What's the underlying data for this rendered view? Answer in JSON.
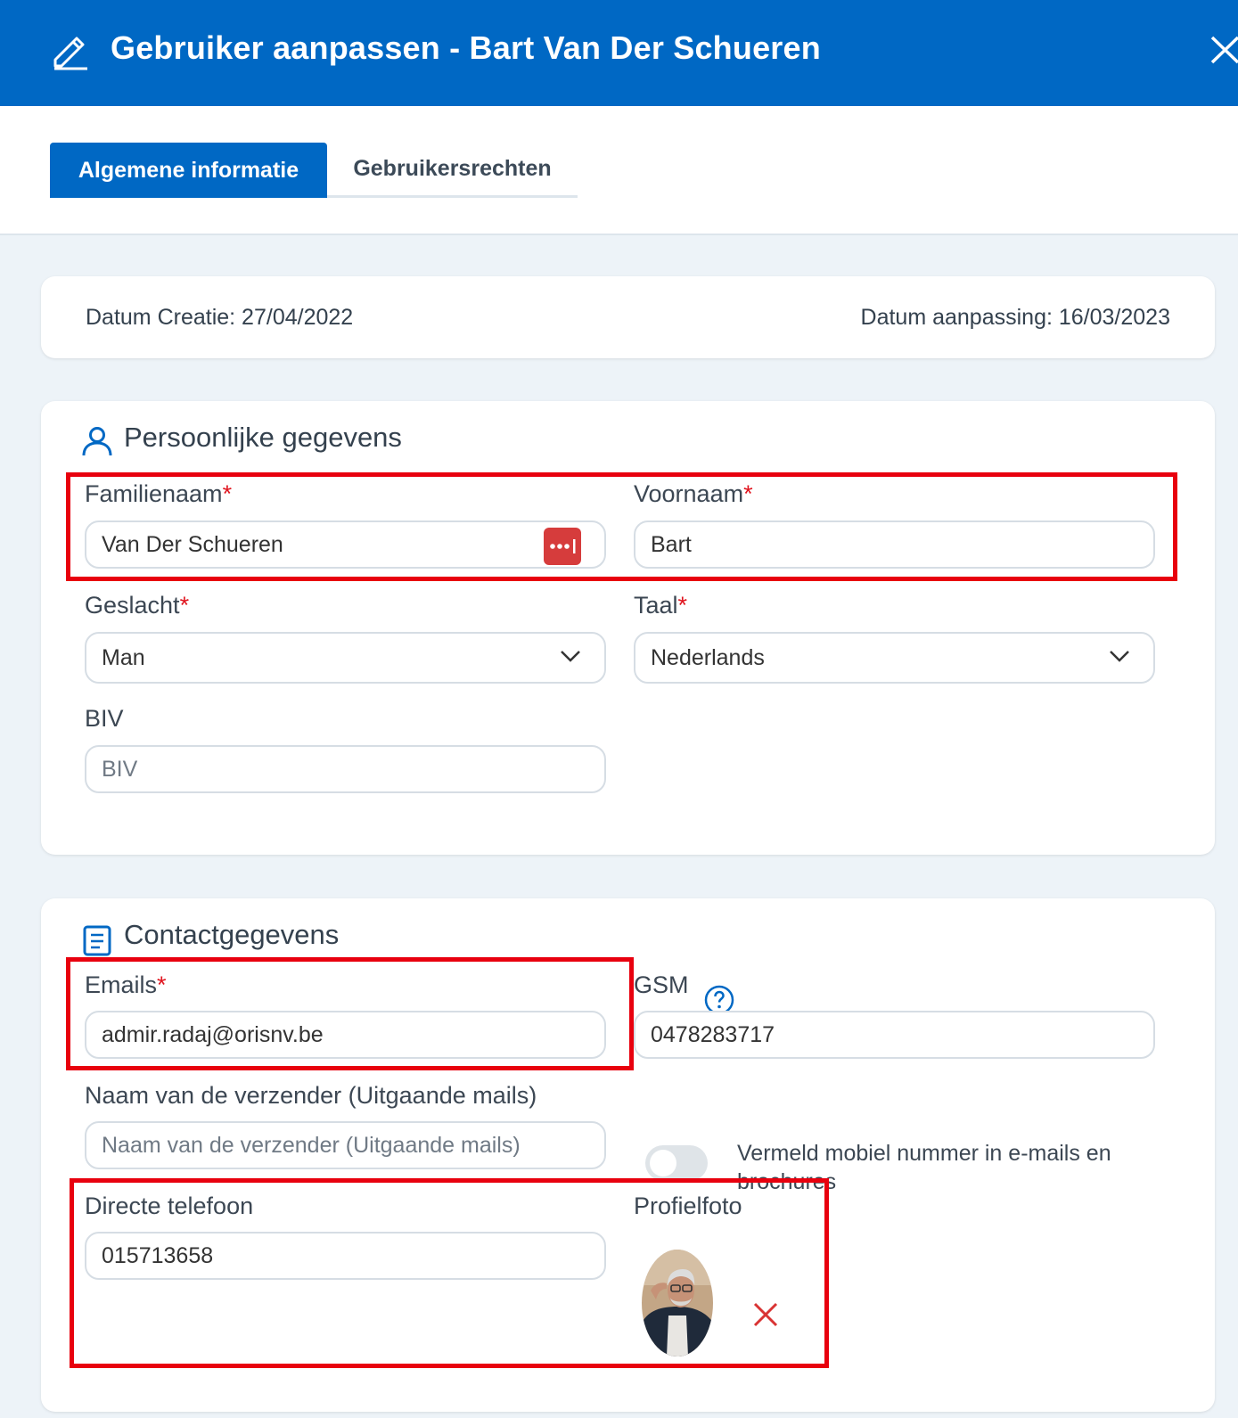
{
  "header": {
    "title": "Gebruiker aanpassen - Bart Van Der Schueren",
    "edit_icon": "pencil-icon",
    "close_icon": "close-icon"
  },
  "tabs": [
    {
      "label": "Algemene informatie",
      "active": true
    },
    {
      "label": "Gebruikersrechten",
      "active": false
    }
  ],
  "dates": {
    "created": "Datum Creatie: 27/04/2022",
    "modified": "Datum aanpassing: 16/03/2023"
  },
  "personal": {
    "title": "Persoonlijke gegevens",
    "icon": "user-icon",
    "familienaam": {
      "label": "Familienaam",
      "value": "Van Der Schueren"
    },
    "voornaam": {
      "label": "Voornaam",
      "value": "Bart"
    },
    "geslacht": {
      "label": "Geslacht",
      "value": "Man"
    },
    "taal": {
      "label": "Taal",
      "value": "Nederlands"
    },
    "biv": {
      "label": "BIV",
      "placeholder": "BIV"
    },
    "required_mark": "*"
  },
  "contact": {
    "title": "Contactgegevens",
    "icon": "document-icon",
    "emails": {
      "label": "Emails",
      "value": "admir.radaj@orisnv.be"
    },
    "gsm": {
      "label": "GSM",
      "value": "0478283717"
    },
    "sender": {
      "label": "Naam van de verzender (Uitgaande mails)",
      "placeholder": "Naam van de verzender (Uitgaande mails)"
    },
    "toggle": {
      "label": "Vermeld mobiel nummer in e-mails en brochures",
      "checked": false
    },
    "direct_phone": {
      "label": "Directe telefoon",
      "value": "015713658"
    },
    "photo": {
      "label": "Profielfoto"
    }
  },
  "colors": {
    "primary": "#0068c4",
    "required": "#e0141e",
    "highlight": "#e8000e",
    "background": "#edf3f8"
  }
}
